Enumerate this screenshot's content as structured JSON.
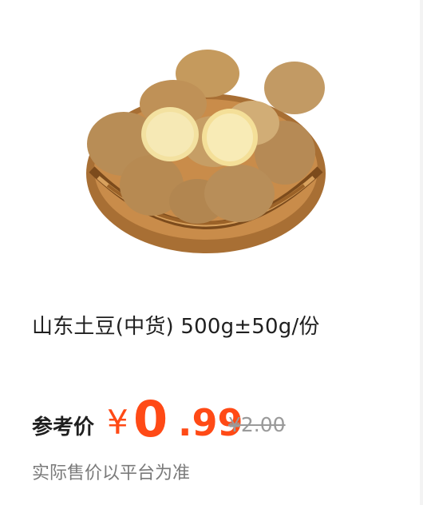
{
  "product": {
    "title": "山东土豆(中货) 500g±50g/份",
    "image_alt": "potatoes-in-basket"
  },
  "price": {
    "label": "参考价",
    "currency": "¥",
    "integer": "0",
    "decimal": ".99",
    "original": "¥2.00"
  },
  "note": "实际售价以平台为准",
  "colors": {
    "price": "#ff4a16",
    "strike": "#9a9a9a"
  }
}
